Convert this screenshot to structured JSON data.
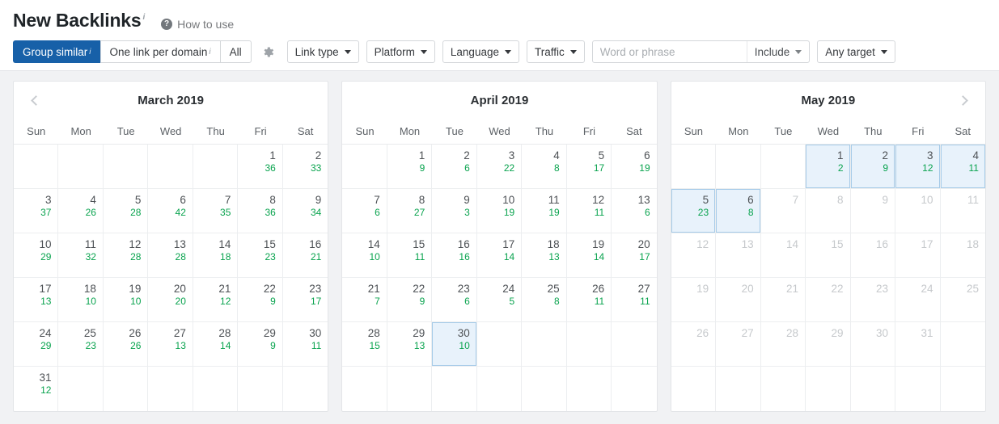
{
  "header": {
    "title": "New Backlinks",
    "title_sup": "i",
    "help_icon": "question-mark-icon",
    "how_to_use": "How to use"
  },
  "toolbar": {
    "segmented": [
      {
        "label": "Group similar",
        "sup": "i",
        "active": true
      },
      {
        "label": "One link per domain",
        "sup": "i",
        "active": false
      },
      {
        "label": "All",
        "sup": "",
        "active": false
      }
    ],
    "gear_icon": "gear-icon",
    "dropdowns": [
      {
        "label": "Link type"
      },
      {
        "label": "Platform"
      },
      {
        "label": "Language"
      },
      {
        "label": "Traffic"
      }
    ],
    "search": {
      "value": "",
      "placeholder": "Word or phrase",
      "mode_label": "Include"
    },
    "target": {
      "label": "Any target"
    }
  },
  "calendars": [
    {
      "title": "March 2019",
      "prev_arrow": true,
      "next_arrow": false,
      "dow": [
        "Sun",
        "Mon",
        "Tue",
        "Wed",
        "Thu",
        "Fri",
        "Sat"
      ],
      "weeks": [
        [
          {},
          {},
          {},
          {},
          {},
          {
            "day": "1",
            "count": "36"
          },
          {
            "day": "2",
            "count": "33"
          }
        ],
        [
          {
            "day": "3",
            "count": "37"
          },
          {
            "day": "4",
            "count": "26"
          },
          {
            "day": "5",
            "count": "28"
          },
          {
            "day": "6",
            "count": "42"
          },
          {
            "day": "7",
            "count": "35"
          },
          {
            "day": "8",
            "count": "36"
          },
          {
            "day": "9",
            "count": "34"
          }
        ],
        [
          {
            "day": "10",
            "count": "29"
          },
          {
            "day": "11",
            "count": "32"
          },
          {
            "day": "12",
            "count": "28"
          },
          {
            "day": "13",
            "count": "28"
          },
          {
            "day": "14",
            "count": "18"
          },
          {
            "day": "15",
            "count": "23"
          },
          {
            "day": "16",
            "count": "21"
          }
        ],
        [
          {
            "day": "17",
            "count": "13"
          },
          {
            "day": "18",
            "count": "10"
          },
          {
            "day": "19",
            "count": "10"
          },
          {
            "day": "20",
            "count": "20"
          },
          {
            "day": "21",
            "count": "12"
          },
          {
            "day": "22",
            "count": "9"
          },
          {
            "day": "23",
            "count": "17"
          }
        ],
        [
          {
            "day": "24",
            "count": "29"
          },
          {
            "day": "25",
            "count": "23"
          },
          {
            "day": "26",
            "count": "26"
          },
          {
            "day": "27",
            "count": "13"
          },
          {
            "day": "28",
            "count": "14"
          },
          {
            "day": "29",
            "count": "9"
          },
          {
            "day": "30",
            "count": "11"
          }
        ],
        [
          {
            "day": "31",
            "count": "12"
          },
          {},
          {},
          {},
          {},
          {},
          {}
        ]
      ]
    },
    {
      "title": "April 2019",
      "prev_arrow": false,
      "next_arrow": false,
      "dow": [
        "Sun",
        "Mon",
        "Tue",
        "Wed",
        "Thu",
        "Fri",
        "Sat"
      ],
      "weeks": [
        [
          {},
          {
            "day": "1",
            "count": "9"
          },
          {
            "day": "2",
            "count": "6"
          },
          {
            "day": "3",
            "count": "22"
          },
          {
            "day": "4",
            "count": "8"
          },
          {
            "day": "5",
            "count": "17"
          },
          {
            "day": "6",
            "count": "19"
          }
        ],
        [
          {
            "day": "7",
            "count": "6"
          },
          {
            "day": "8",
            "count": "27"
          },
          {
            "day": "9",
            "count": "3"
          },
          {
            "day": "10",
            "count": "19"
          },
          {
            "day": "11",
            "count": "19"
          },
          {
            "day": "12",
            "count": "11"
          },
          {
            "day": "13",
            "count": "6"
          }
        ],
        [
          {
            "day": "14",
            "count": "10"
          },
          {
            "day": "15",
            "count": "11"
          },
          {
            "day": "16",
            "count": "16"
          },
          {
            "day": "17",
            "count": "14"
          },
          {
            "day": "18",
            "count": "13"
          },
          {
            "day": "19",
            "count": "14"
          },
          {
            "day": "20",
            "count": "17"
          }
        ],
        [
          {
            "day": "21",
            "count": "7"
          },
          {
            "day": "22",
            "count": "9"
          },
          {
            "day": "23",
            "count": "6"
          },
          {
            "day": "24",
            "count": "5"
          },
          {
            "day": "25",
            "count": "8"
          },
          {
            "day": "26",
            "count": "11"
          },
          {
            "day": "27",
            "count": "11"
          }
        ],
        [
          {
            "day": "28",
            "count": "15"
          },
          {
            "day": "29",
            "count": "13"
          },
          {
            "day": "30",
            "count": "10",
            "selected": true
          },
          {},
          {},
          {},
          {}
        ],
        [
          {},
          {},
          {},
          {},
          {},
          {},
          {}
        ]
      ]
    },
    {
      "title": "May 2019",
      "prev_arrow": false,
      "next_arrow": true,
      "dow": [
        "Sun",
        "Mon",
        "Tue",
        "Wed",
        "Thu",
        "Fri",
        "Sat"
      ],
      "weeks": [
        [
          {},
          {},
          {},
          {
            "day": "1",
            "count": "2",
            "selected": true
          },
          {
            "day": "2",
            "count": "9",
            "selected": true
          },
          {
            "day": "3",
            "count": "12",
            "selected": true
          },
          {
            "day": "4",
            "count": "11",
            "selected": true
          }
        ],
        [
          {
            "day": "5",
            "count": "23",
            "selected": true
          },
          {
            "day": "6",
            "count": "8",
            "selected": true
          },
          {
            "day": "7",
            "muted": true
          },
          {
            "day": "8",
            "muted": true
          },
          {
            "day": "9",
            "muted": true
          },
          {
            "day": "10",
            "muted": true
          },
          {
            "day": "11",
            "muted": true
          }
        ],
        [
          {
            "day": "12",
            "muted": true
          },
          {
            "day": "13",
            "muted": true
          },
          {
            "day": "14",
            "muted": true
          },
          {
            "day": "15",
            "muted": true
          },
          {
            "day": "16",
            "muted": true
          },
          {
            "day": "17",
            "muted": true
          },
          {
            "day": "18",
            "muted": true
          }
        ],
        [
          {
            "day": "19",
            "muted": true
          },
          {
            "day": "20",
            "muted": true
          },
          {
            "day": "21",
            "muted": true
          },
          {
            "day": "22",
            "muted": true
          },
          {
            "day": "23",
            "muted": true
          },
          {
            "day": "24",
            "muted": true
          },
          {
            "day": "25",
            "muted": true
          }
        ],
        [
          {
            "day": "26",
            "muted": true
          },
          {
            "day": "27",
            "muted": true
          },
          {
            "day": "28",
            "muted": true
          },
          {
            "day": "29",
            "muted": true
          },
          {
            "day": "30",
            "muted": true
          },
          {
            "day": "31",
            "muted": true
          },
          {}
        ],
        [
          {},
          {},
          {},
          {},
          {},
          {},
          {}
        ]
      ]
    }
  ],
  "colors": {
    "accent_blue": "#1760a8",
    "count_green": "#09a34e",
    "selected_bg": "#e8f2fb",
    "selected_border": "#a6cbe8",
    "page_bg": "#f1f2f4"
  }
}
